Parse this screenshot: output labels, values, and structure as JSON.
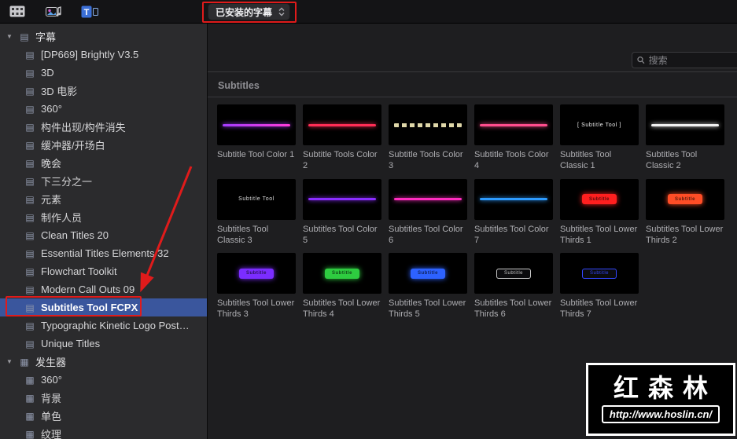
{
  "toolbar": {
    "icons": [
      "media-browser-icon",
      "photos-audio-icon",
      "titles-generators-icon"
    ],
    "dropdown": {
      "label": "已安装的字幕"
    }
  },
  "search": {
    "placeholder": "搜索"
  },
  "sidebar": {
    "sections": [
      {
        "label": "字幕",
        "icon": "titles-icon",
        "items": [
          {
            "label": "[DP669] Brightly V3.5"
          },
          {
            "label": "3D"
          },
          {
            "label": "3D 电影"
          },
          {
            "label": "360°"
          },
          {
            "label": "构件出现/构件消失"
          },
          {
            "label": "缓冲器/开场白"
          },
          {
            "label": "晚会"
          },
          {
            "label": "下三分之一"
          },
          {
            "label": "元素"
          },
          {
            "label": "制作人员"
          },
          {
            "label": "Clean Titles 20"
          },
          {
            "label": "Essential Titles Elements 32"
          },
          {
            "label": "Flowchart Toolkit"
          },
          {
            "label": "Modern Call Outs 09"
          },
          {
            "label": "Subtitles Tool FCPX",
            "selected": true
          },
          {
            "label": "Typographic Kinetic Logo Post…"
          },
          {
            "label": "Unique Titles"
          }
        ]
      },
      {
        "label": "发生器",
        "icon": "generators-icon",
        "items": [
          {
            "label": "360°"
          },
          {
            "label": "背景"
          },
          {
            "label": "单色"
          },
          {
            "label": "纹理"
          }
        ]
      }
    ]
  },
  "content": {
    "section_title": "Subtitles",
    "items": [
      {
        "label": "Subtitle Tool Color 1",
        "kind": "line",
        "color": "#a33cff",
        "color2": "#ff3cd8"
      },
      {
        "label": "Subtitle Tools Color 2",
        "kind": "line",
        "color": "#ff2d55"
      },
      {
        "label": "Subtitle Tools Color 3",
        "kind": "dashline",
        "color": "#ded6a8"
      },
      {
        "label": "Subtitle Tools Color 4",
        "kind": "line",
        "color": "#ff4d8d"
      },
      {
        "label": "Subtitles Tool Classic 1",
        "kind": "text",
        "color": "#f0f0f0",
        "text": "[ Subtitle Tool ]"
      },
      {
        "label": "Subtitles Tool Classic 2",
        "kind": "line",
        "color": "#f0f0f0"
      },
      {
        "label": "Subtitles Tool Classic 3",
        "kind": "text",
        "color": "#dddddd",
        "text": "Subtitle Tool"
      },
      {
        "label": "Subtitles Tool Color 5",
        "kind": "line",
        "color": "#8a2dff"
      },
      {
        "label": "Subtitles Tool Color 6",
        "kind": "line",
        "color": "#ff2dc0"
      },
      {
        "label": "Subtitles Tool Color 7",
        "kind": "line",
        "color": "#2d9bff"
      },
      {
        "label": "Subtitles Tool Lower Thirds 1",
        "kind": "pill",
        "color": "#ff1f1f",
        "text": "Subtitle"
      },
      {
        "label": "Subtitles Tool Lower Thirds 2",
        "kind": "pill",
        "color": "#ff4d26",
        "text": "Subtitle"
      },
      {
        "label": "Subtitles Tool Lower Thirds 3",
        "kind": "pill",
        "color": "#7b2dff",
        "text": "Subtitle"
      },
      {
        "label": "Subtitles Tool Lower Thirds 4",
        "kind": "pill",
        "color": "#2ecc40",
        "text": "Subtitle"
      },
      {
        "label": "Subtitles Tool Lower Thirds 5",
        "kind": "pill",
        "color": "#2d62ff",
        "text": "Subtitle"
      },
      {
        "label": "Subtitles Tool Lower Thirds 6",
        "kind": "pill-dark",
        "color": "#c8c8c8",
        "text": "Subtitle"
      },
      {
        "label": "Subtitles Tool Lower Thirds 7",
        "kind": "pill-dark",
        "color": "#3347ff",
        "text": "Subtitle"
      }
    ]
  },
  "watermark": {
    "title": "红森林",
    "url": "http://www.hoslin.cn/"
  }
}
